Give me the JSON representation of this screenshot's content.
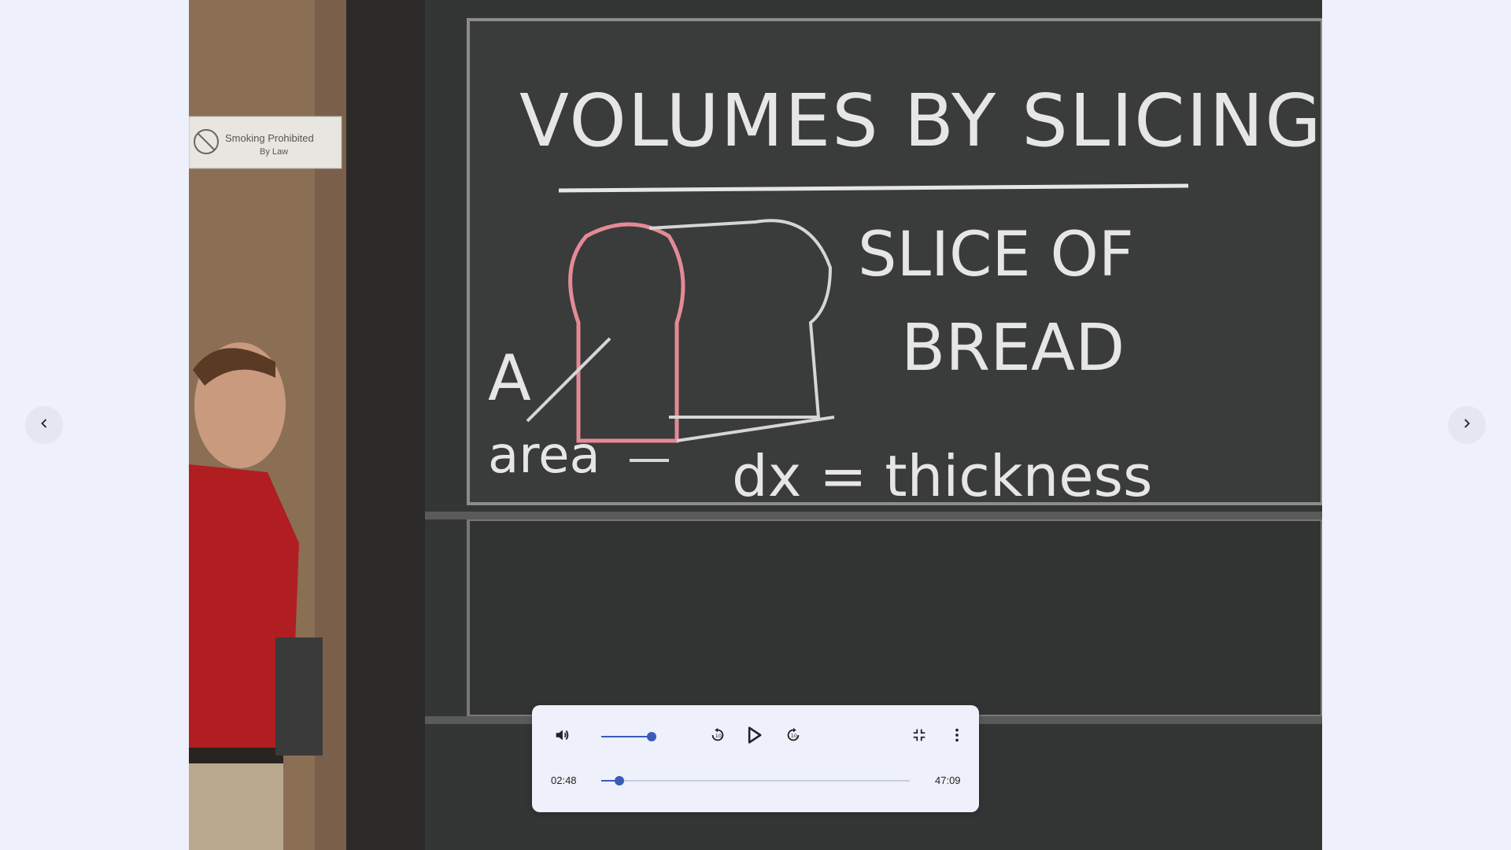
{
  "video": {
    "title_chalk": "VOLUMES BY SLICING",
    "slice_line1": "SLICE OF",
    "slice_line2": "BREAD",
    "label_a": "A",
    "label_area": "area",
    "label_dx": "dx = thickness",
    "sign_line1": "Smoking Prohibited",
    "sign_line2": "By Law"
  },
  "navigation": {
    "prev_icon": "chevron-left-icon",
    "next_icon": "chevron-right-icon"
  },
  "player": {
    "current_time": "02:48",
    "duration": "47:09",
    "progress": 0.059,
    "volume": 0.85,
    "accent_color": "#3a5bb8",
    "icons": {
      "volume": "volume-icon",
      "rewind": "replay-10-icon",
      "play": "play-icon",
      "forward": "forward-10-icon",
      "exit_fullscreen": "exit-fullscreen-icon",
      "more": "more-vert-icon"
    }
  }
}
